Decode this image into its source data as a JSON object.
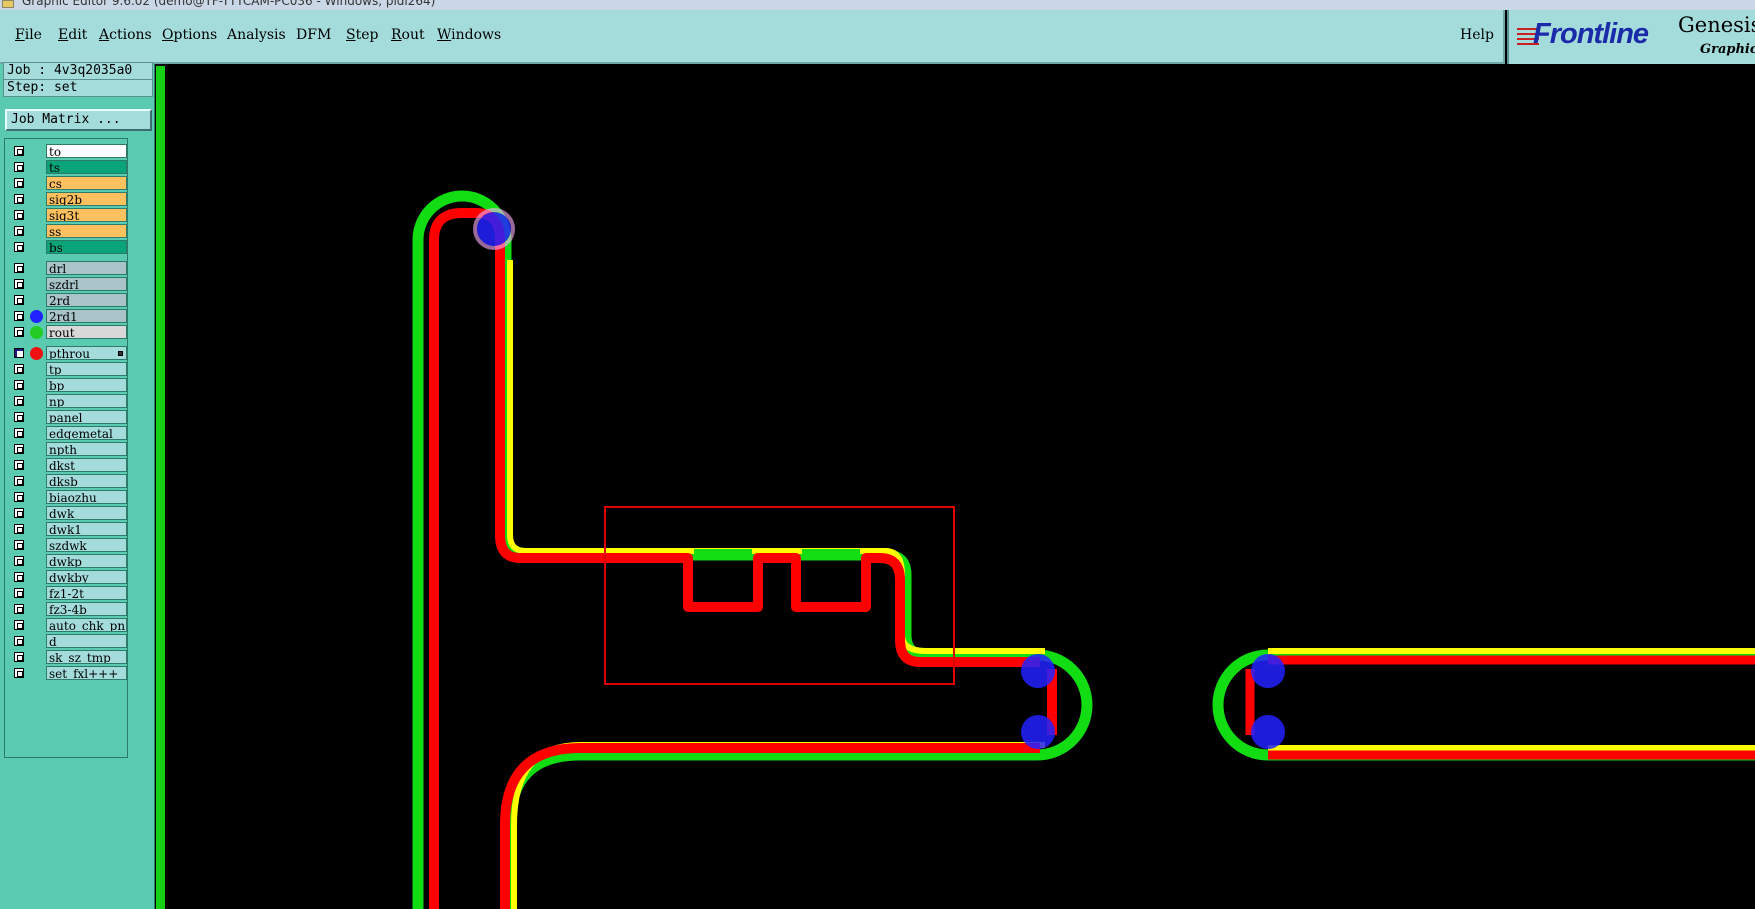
{
  "titlebar": {
    "text": "Graphic Editor 9.6.02 (demo@TF-TTTCAM-PC036 - Windows, pidl264)"
  },
  "menu": {
    "items": [
      {
        "label": "File",
        "ul": "F"
      },
      {
        "label": "Edit",
        "ul": "E"
      },
      {
        "label": "Actions",
        "ul": "A"
      },
      {
        "label": "Options",
        "ul": "O"
      },
      {
        "label": "Analysis",
        "ul": ""
      },
      {
        "label": "DFM",
        "ul": ""
      },
      {
        "label": "Step",
        "ul": "S"
      },
      {
        "label": "Rout",
        "ul": "R"
      },
      {
        "label": "Windows",
        "ul": "W"
      }
    ],
    "help": "Help"
  },
  "logo": {
    "brand": "Frontline",
    "product": "Genesis",
    "subtitle": "Graphic Editor"
  },
  "job": {
    "line": "Job : 4v3q2035a0",
    "step": "Step: set",
    "matrix_button": "Job Matrix ..."
  },
  "layers": [
    {
      "name": "to",
      "color": "#ffffff",
      "dot": "",
      "checked": false
    },
    {
      "name": "ts",
      "color": "#0aa478",
      "dot": "",
      "checked": false
    },
    {
      "name": "cs",
      "color": "#ffc060",
      "dot": "",
      "checked": false
    },
    {
      "name": "sig2b",
      "color": "#ffc060",
      "dot": "",
      "checked": false
    },
    {
      "name": "sig3t",
      "color": "#ffc060",
      "dot": "",
      "checked": false
    },
    {
      "name": "ss",
      "color": "#ffc060",
      "dot": "",
      "checked": false
    },
    {
      "name": "bs",
      "color": "#0aa478",
      "dot": "",
      "checked": false,
      "gap_after": true
    },
    {
      "name": "drl",
      "color": "#a8c4c8",
      "dot": "",
      "checked": false
    },
    {
      "name": "szdrl",
      "color": "#a8c4c8",
      "dot": "",
      "checked": false
    },
    {
      "name": "2rd",
      "color": "#a8c4c8",
      "dot": "",
      "checked": false
    },
    {
      "name": "2rd1",
      "color": "#a8c4c8",
      "dot": "#2222ff",
      "checked": false
    },
    {
      "name": "rout",
      "color": "#d8d8d8",
      "dot": "#22cc22",
      "checked": false,
      "gap_after": true
    },
    {
      "name": "pthrou",
      "color": "#a4dcdc",
      "dot": "#ee1111",
      "checked": true,
      "flag": true
    },
    {
      "name": "tp",
      "color": "#a4dcdc",
      "dot": "",
      "checked": false
    },
    {
      "name": "bp",
      "color": "#a4dcdc",
      "dot": "",
      "checked": false
    },
    {
      "name": "np",
      "color": "#a4dcdc",
      "dot": "",
      "checked": false
    },
    {
      "name": "panel",
      "color": "#a4dcdc",
      "dot": "",
      "checked": false
    },
    {
      "name": "edgemetal",
      "color": "#a4dcdc",
      "dot": "",
      "checked": false
    },
    {
      "name": "npth",
      "color": "#a4dcdc",
      "dot": "",
      "checked": false
    },
    {
      "name": "dkst",
      "color": "#a4dcdc",
      "dot": "",
      "checked": false
    },
    {
      "name": "dksb",
      "color": "#a4dcdc",
      "dot": "",
      "checked": false
    },
    {
      "name": "biaozhu",
      "color": "#a4dcdc",
      "dot": "",
      "checked": false
    },
    {
      "name": "dwk",
      "color": "#a4dcdc",
      "dot": "",
      "checked": false
    },
    {
      "name": "dwk1",
      "color": "#a4dcdc",
      "dot": "",
      "checked": false
    },
    {
      "name": "szdwk",
      "color": "#a4dcdc",
      "dot": "",
      "checked": false
    },
    {
      "name": "dwkp",
      "color": "#a4dcdc",
      "dot": "",
      "checked": false
    },
    {
      "name": "dwkby",
      "color": "#a4dcdc",
      "dot": "",
      "checked": false
    },
    {
      "name": "fz1-2t",
      "color": "#a4dcdc",
      "dot": "",
      "checked": false
    },
    {
      "name": "fz3-4b",
      "color": "#a4dcdc",
      "dot": "",
      "checked": false
    },
    {
      "name": "auto_chk_pn",
      "color": "#a4dcdc",
      "dot": "",
      "checked": false
    },
    {
      "name": "d",
      "color": "#a4dcdc",
      "dot": "",
      "checked": false
    },
    {
      "name": "sk_sz_tmp",
      "color": "#a4dcdc",
      "dot": "",
      "checked": false
    },
    {
      "name": "set_fxl+++",
      "color": "#a4dcdc",
      "dot": "",
      "checked": false
    }
  ],
  "colors": {
    "rout": "#12dd12",
    "pthrou": "#ff0000",
    "overlap": "#ffff00",
    "drill": "#2222ff",
    "highlight_box": "#e00000"
  }
}
